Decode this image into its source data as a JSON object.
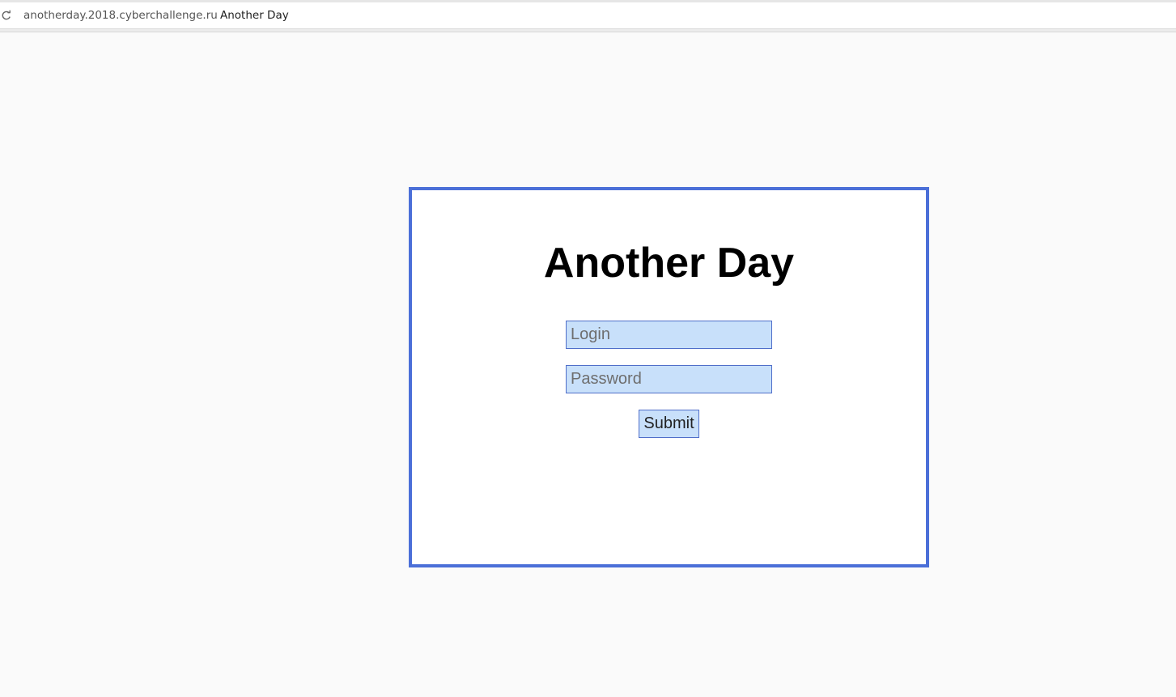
{
  "browser": {
    "url": "anotherday.2018.cyberchallenge.ru",
    "tab_title": "Another Day",
    "reload_icon": "reload-icon"
  },
  "form": {
    "heading": "Another Day",
    "login_placeholder": "Login",
    "login_value": "",
    "password_placeholder": "Password",
    "password_value": "",
    "submit_label": "Submit"
  },
  "colors": {
    "card_border": "#4b6fd8",
    "field_background": "#c8e0fa",
    "field_border": "#4f6ec9",
    "page_background": "#fafafa"
  }
}
